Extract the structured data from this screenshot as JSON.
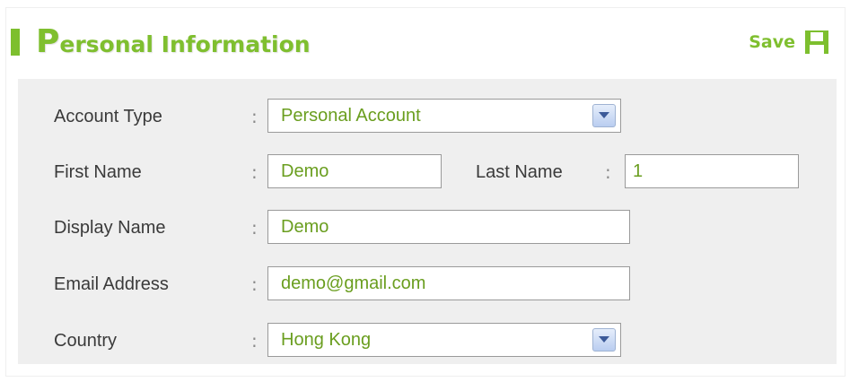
{
  "header": {
    "title_first_letter": "P",
    "title_rest": "ersonal Information",
    "save_label": "Save",
    "save_icon": "floppy-disk-icon"
  },
  "form": {
    "account_type": {
      "label": "Account Type",
      "separator": ":",
      "value": "Personal Account"
    },
    "first_name": {
      "label": "First Name",
      "separator": ":",
      "value": "Demo"
    },
    "last_name": {
      "label": "Last Name",
      "separator": ":",
      "value": "1"
    },
    "display_name": {
      "label": "Display Name",
      "separator": ":",
      "value": "Demo"
    },
    "email": {
      "label": "Email Address",
      "separator": ":",
      "value": "demo@gmail.com"
    },
    "country": {
      "label": "Country",
      "separator": ":",
      "value": "Hong Kong"
    }
  },
  "colors": {
    "accent_green": "#7fbf2f",
    "value_green": "#6a9e1f",
    "form_background": "#efefef"
  }
}
